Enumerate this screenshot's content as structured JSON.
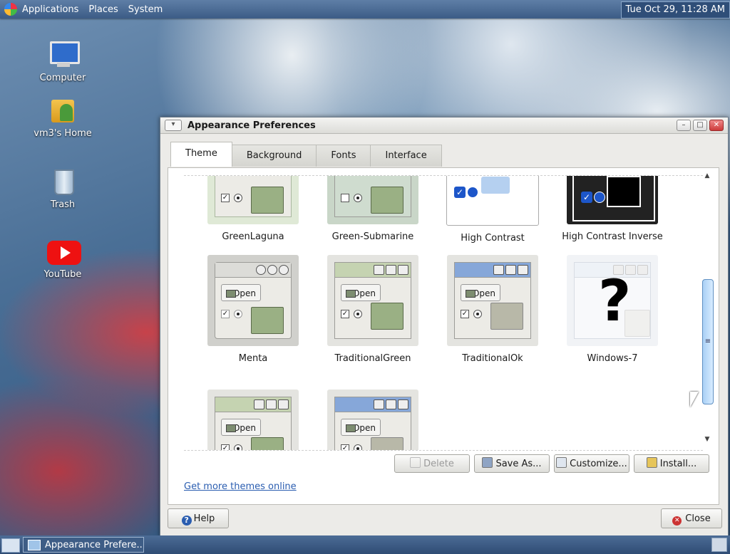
{
  "top_panel": {
    "menus": [
      "Applications",
      "Places",
      "System"
    ],
    "clock": "Tue Oct 29, 11:28 AM"
  },
  "desktop_icons": [
    {
      "label": "Computer",
      "icon": "computer-icon"
    },
    {
      "label": "vm3's Home",
      "icon": "home-folder-icon"
    },
    {
      "label": "Trash",
      "icon": "trash-icon"
    },
    {
      "label": "YouTube",
      "icon": "youtube-icon"
    }
  ],
  "window": {
    "title": "Appearance Preferences",
    "tabs": [
      "Theme",
      "Background",
      "Fonts",
      "Interface"
    ],
    "active_tab": "Theme",
    "themes": [
      "GreenLaguna",
      "Green-Submarine",
      "High Contrast",
      "High Contrast Inverse",
      "Menta",
      "TraditionalGreen",
      "TraditionalOk",
      "Windows-7"
    ],
    "preview_open_label": "Open",
    "windows7_symbol": "?",
    "buttons": {
      "delete": "Delete",
      "save_as": "Save As...",
      "customize": "Customize...",
      "install": "Install..."
    },
    "link": "Get more themes online",
    "help": "Help",
    "close": "Close",
    "colors": {
      "link": "#2a5db0",
      "scroll_thumb": "#a9d0f5"
    }
  },
  "taskbar": {
    "task_label": "Appearance Prefere..."
  }
}
